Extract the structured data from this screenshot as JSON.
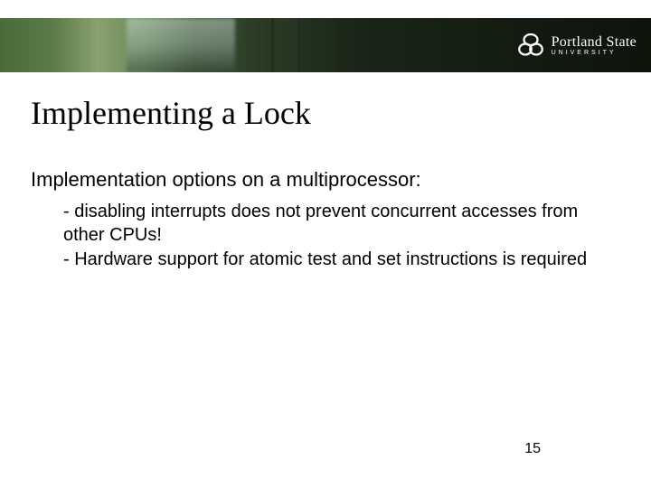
{
  "brand": {
    "name": "Portland State",
    "subname": "UNIVERSITY"
  },
  "title": "Implementing a Lock",
  "subhead": "Implementation options on a multiprocessor:",
  "bullets": [
    "- disabling interrupts does not prevent concurrent accesses from other CPUs!",
    "- Hardware support for atomic test and set instructions is required"
  ],
  "page_number": "15"
}
